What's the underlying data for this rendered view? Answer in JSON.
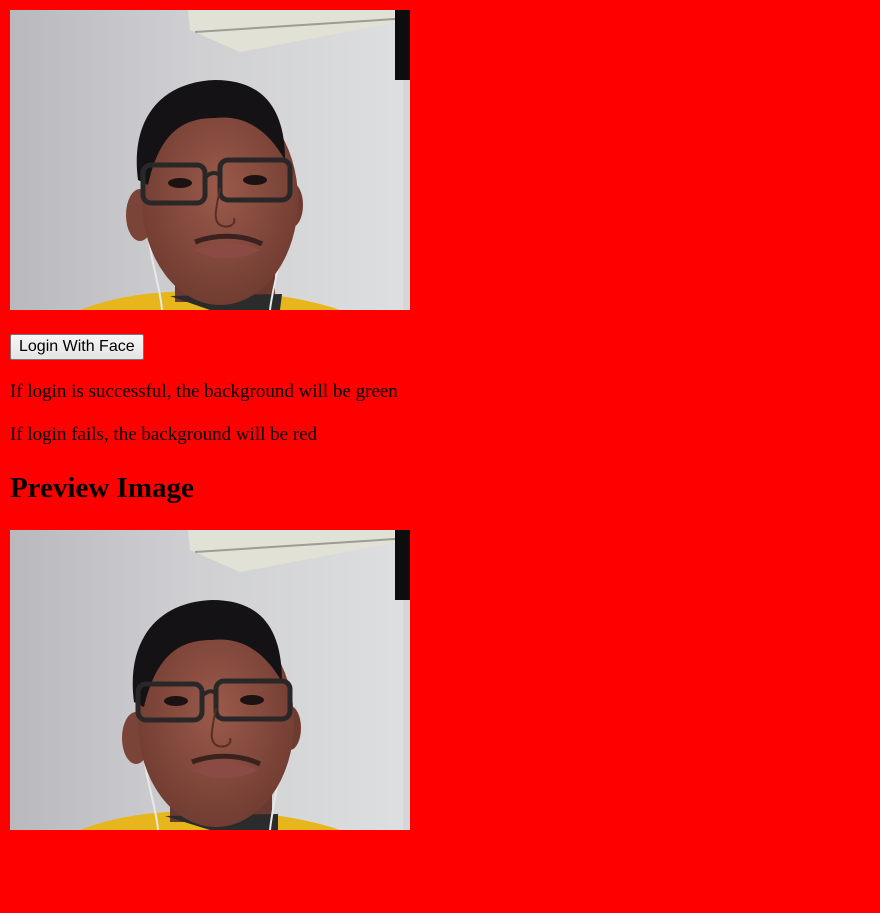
{
  "page": {
    "background_color": "#ff0000"
  },
  "webcam": {
    "image_kind": "webcam-photo"
  },
  "login_button": {
    "label": "Login With Face"
  },
  "messages": {
    "success": "If login is successful, the background will be green",
    "failure": "If login fails, the background will be red"
  },
  "preview": {
    "heading": "Preview Image",
    "image_kind": "webcam-photo"
  }
}
